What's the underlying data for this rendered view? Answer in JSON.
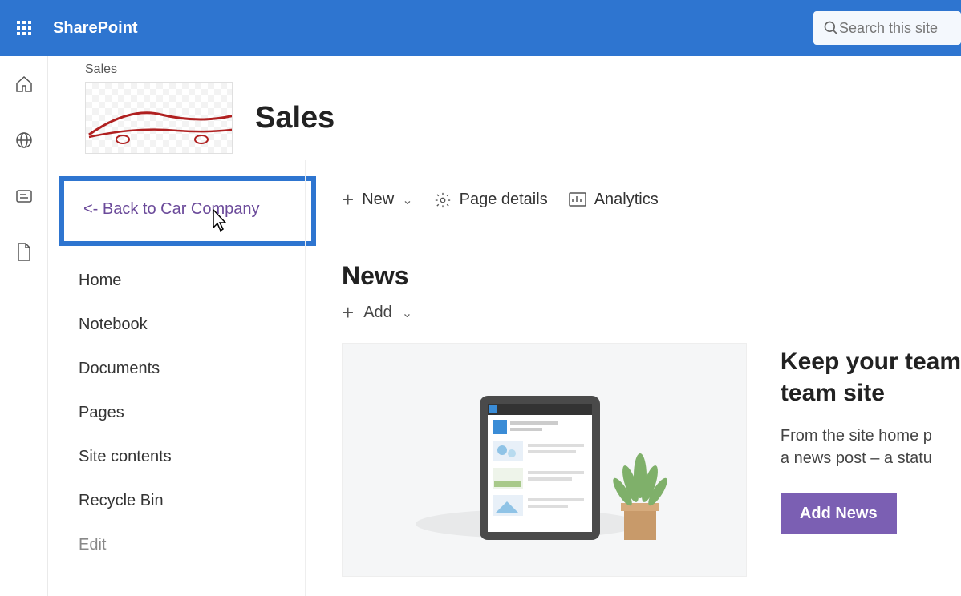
{
  "suitebar": {
    "app_name": "SharePoint",
    "search_placeholder": "Search this site"
  },
  "header": {
    "breadcrumb": "Sales",
    "site_title": "Sales"
  },
  "leftnav": {
    "back_label": "<- Back to Car Company",
    "items": [
      "Home",
      "Notebook",
      "Documents",
      "Pages",
      "Site contents",
      "Recycle Bin"
    ],
    "edit_label": "Edit"
  },
  "commands": {
    "new_label": "New",
    "page_details_label": "Page details",
    "analytics_label": "Analytics"
  },
  "news": {
    "section_title": "News",
    "add_label": "Add",
    "keep_title_line1": "Keep your team",
    "keep_title_line2": "team site",
    "keep_body_line1": "From the site home p",
    "keep_body_line2": "a news post – a statu",
    "add_news_btn": "Add News"
  }
}
